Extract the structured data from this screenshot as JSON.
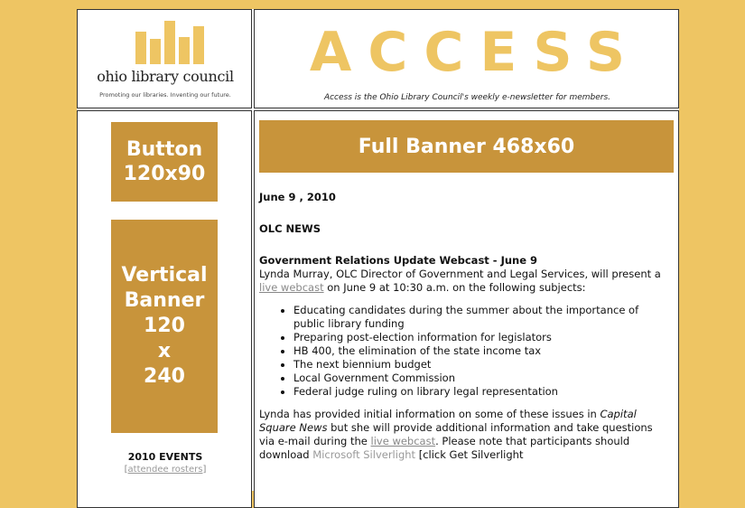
{
  "logo": {
    "name": "ohio library council",
    "tagline": "Promoting our libraries. Inventing our future."
  },
  "header": {
    "title": "ACCESS",
    "subtitle": "Access is the Ohio Library Council's weekly e-newsletter for members."
  },
  "sidebar": {
    "button_ad": [
      "Button",
      "120x90"
    ],
    "vertical_ad": [
      "Vertical",
      "Banner",
      "120",
      "x",
      "240"
    ],
    "events_title": "2010 EVENTS",
    "events_link_open": "[",
    "events_link": "attendee rosters",
    "events_link_close": "]"
  },
  "main": {
    "banner": "Full Banner 468x60",
    "date": "June 9 , 2010",
    "section": "OLC NEWS",
    "article_title": "Government Relations Update Webcast - June 9",
    "intro_pre": "Lynda Murray, OLC Director of Government and Legal Services, will present a ",
    "intro_link": "live webcast",
    "intro_post": " on June 9 at 10:30 a.m. on the following subjects:",
    "bullets": [
      "Educating candidates during the summer about the importance of public library funding",
      "Preparing post-election information for legislators",
      "HB 400, the elimination of the state income tax",
      "The next biennium budget",
      "Local Government Commission",
      "Federal judge ruling on library legal representation"
    ],
    "para2_a": "Lynda has provided initial information on some of these issues in ",
    "para2_italic": "Capital Square News",
    "para2_b": " but she will provide additional information and take questions via e-mail during the ",
    "para2_link": "live webcast",
    "para2_c": ". Please note that participants should download ",
    "para2_link2": "Microsoft Silverlight",
    "para2_d": " [click Get Silverlight"
  },
  "colors": {
    "background": "#eec563",
    "ad_fill": "#c8943b"
  }
}
